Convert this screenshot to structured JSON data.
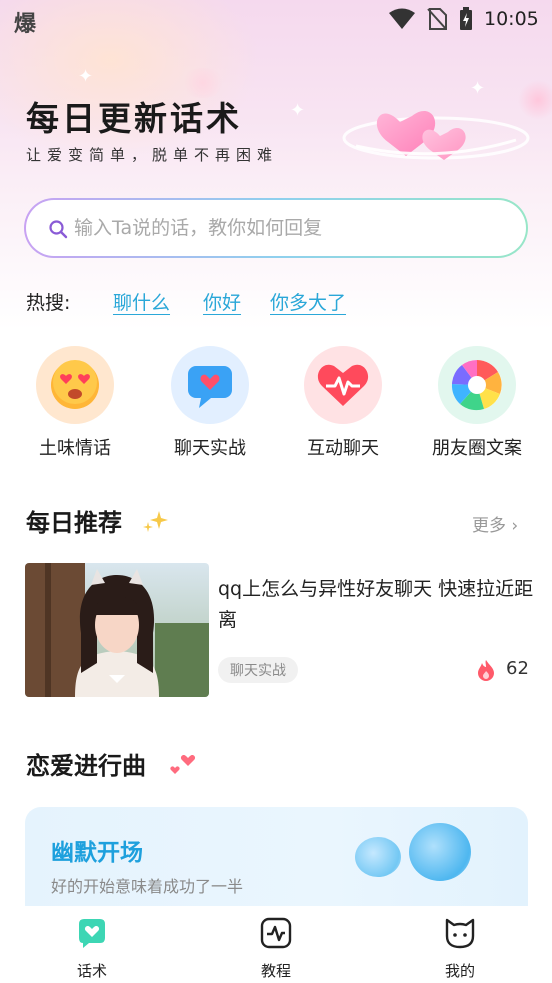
{
  "status_bar": {
    "left_glyph": "爆",
    "time": "10:05",
    "icons": [
      "wifi-icon",
      "no-sim-icon",
      "battery-charging-icon"
    ]
  },
  "hero": {
    "title": "每日更新话术",
    "subtitle": "让爱变简单，脱单不再困难"
  },
  "search": {
    "placeholder": "输入Ta说的话，教你如何回复",
    "value": ""
  },
  "hot_search": {
    "label": "热搜:",
    "items": [
      "聊什么",
      "你好",
      "你多大了"
    ]
  },
  "categories": [
    {
      "label": "土味情话",
      "icon": "heart-eyes-emoji-icon",
      "color": "#ffe7cf"
    },
    {
      "label": "聊天实战",
      "icon": "chat-heart-icon",
      "color": "#e2efff"
    },
    {
      "label": "互动聊天",
      "icon": "heartbeat-icon",
      "color": "#ffe2e4"
    },
    {
      "label": "朋友圈文案",
      "icon": "camera-aperture-icon",
      "color": "#e2f7ee"
    }
  ],
  "daily": {
    "title": "每日推荐",
    "more_label": "更多 ›",
    "item": {
      "title": "qq上怎么与异性好友聊天 快速拉近距离",
      "tag": "聊天实战",
      "count": "62"
    }
  },
  "love": {
    "title": "恋爱进行曲",
    "card_title": "幽默开场",
    "card_desc": "好的开始意味着成功了一半"
  },
  "nav": [
    {
      "label": "话术",
      "icon": "chat-heart-nav-icon",
      "active": true
    },
    {
      "label": "教程",
      "icon": "pulse-nav-icon",
      "active": false
    },
    {
      "label": "我的",
      "icon": "cat-face-nav-icon",
      "active": false
    }
  ],
  "colors": {
    "accent": "#2aa7d8",
    "active_nav": "#3dd6b4",
    "card_title": "#1ea0dd"
  }
}
